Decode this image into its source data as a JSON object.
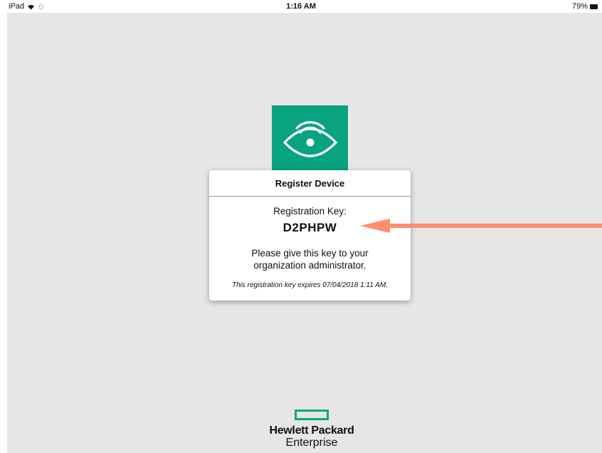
{
  "status_bar": {
    "device": "iPad",
    "time": "1:16 AM",
    "battery": "79%",
    "wifi_icon": "wifi-icon",
    "activity_icon": "activity-spinner-icon"
  },
  "app_icon": {
    "name": "eye-signal-icon",
    "color": "#0aa37f"
  },
  "dialog": {
    "title": "Register Device",
    "key_label": "Registration Key:",
    "key_value": "D2PHPW",
    "message": "Please give this key to your organization administrator.",
    "expiry": "This registration key expires 07/04/2018 1:11 AM."
  },
  "annotation_arrow": {
    "color": "#ff8e6e"
  },
  "brand": {
    "line1": "Hewlett Packard",
    "line2": "Enterprise",
    "color": "#01a982"
  }
}
